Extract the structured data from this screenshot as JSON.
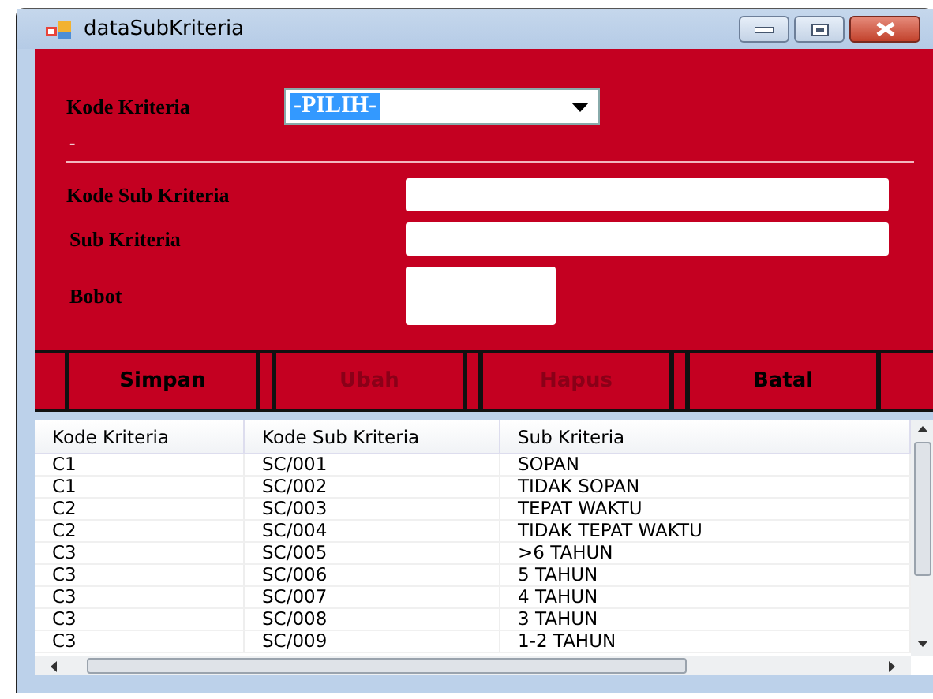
{
  "window": {
    "title": "dataSubKriteria"
  },
  "form": {
    "combo": {
      "label": "Kode Kriteria",
      "value": "-PILIH-",
      "selected": true
    },
    "status": "-",
    "fields": [
      {
        "label": "Kode Sub Kriteria",
        "kind": "wide"
      },
      {
        "label": "Sub Kriteria",
        "kind": "wide"
      },
      {
        "label": "Bobot",
        "kind": "box"
      }
    ]
  },
  "buttons": [
    {
      "label": "Simpan",
      "disabled": false
    },
    {
      "label": "Ubah",
      "disabled": true
    },
    {
      "label": "Hapus",
      "disabled": true
    },
    {
      "label": "Batal",
      "disabled": false
    }
  ],
  "table": {
    "columns": [
      "Kode Kriteria",
      "Kode Sub Kriteria",
      "Sub Kriteria"
    ],
    "rows": [
      [
        "C1",
        "SC/001",
        "SOPAN"
      ],
      [
        "C1",
        "SC/002",
        "TIDAK SOPAN"
      ],
      [
        "C2",
        "SC/003",
        "TEPAT WAKTU"
      ],
      [
        "C2",
        "SC/004",
        "TIDAK TEPAT WAKTU"
      ],
      [
        "C3",
        "SC/005",
        ">6 TAHUN"
      ],
      [
        "C3",
        "SC/006",
        "5 TAHUN"
      ],
      [
        "C3",
        "SC/007",
        "4 TAHUN"
      ],
      [
        "C3",
        "SC/008",
        "3 TAHUN"
      ],
      [
        "C3",
        "SC/009",
        "1-2 TAHUN"
      ]
    ]
  }
}
